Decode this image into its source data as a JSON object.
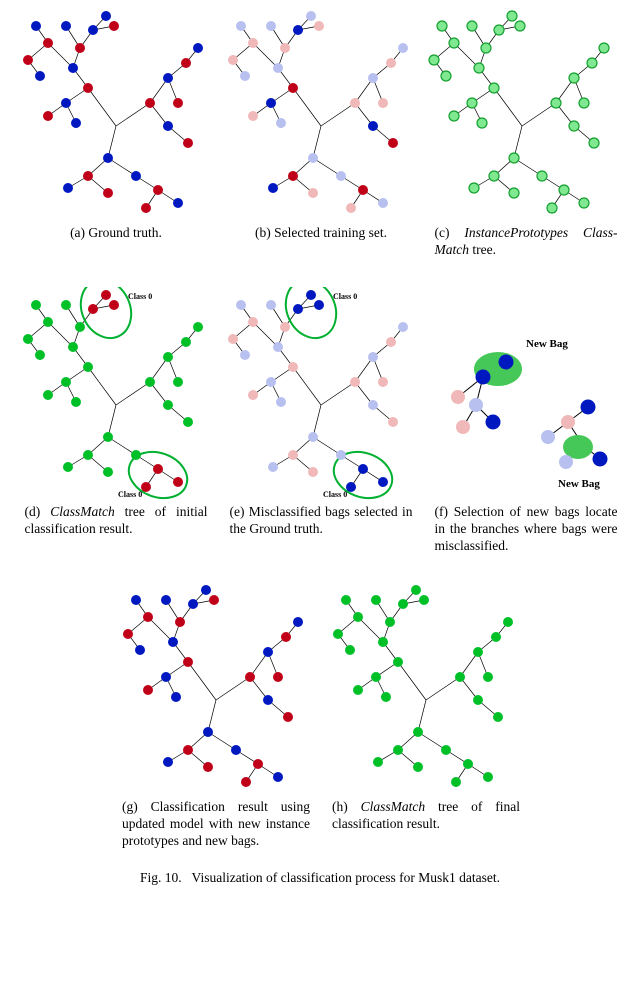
{
  "fig_number": "Fig. 10.",
  "fig_title": "Visualization of classification process for Musk1 dataset.",
  "subfigs": {
    "a": {
      "id": "(a)",
      "text": " Ground truth."
    },
    "b": {
      "id": "(b)",
      "text": " Selected training set."
    },
    "c": {
      "id": "(c)",
      "pre": " ",
      "ital1": "InstancePrototypes Class-Match",
      "post": " tree."
    },
    "d": {
      "id": "(d)",
      "pre": " ",
      "ital1": "ClassMatch",
      "post": " tree of initial classification result."
    },
    "e": {
      "id": "(e)",
      "text": " Misclassified bags selected in the Ground truth."
    },
    "f": {
      "id": "(f)",
      "text": " Selection of new bags locate in the branches where bags were misclassified."
    },
    "g": {
      "id": "(g)",
      "text": " Classification result using updated model with new instance prototypes and new bags."
    },
    "h": {
      "id": "(h)",
      "pre": " ",
      "ital1": "ClassMatch",
      "post": " tree of final classification result."
    }
  },
  "annotations": {
    "class0": "Class 0",
    "newbag": "New Bag"
  }
}
